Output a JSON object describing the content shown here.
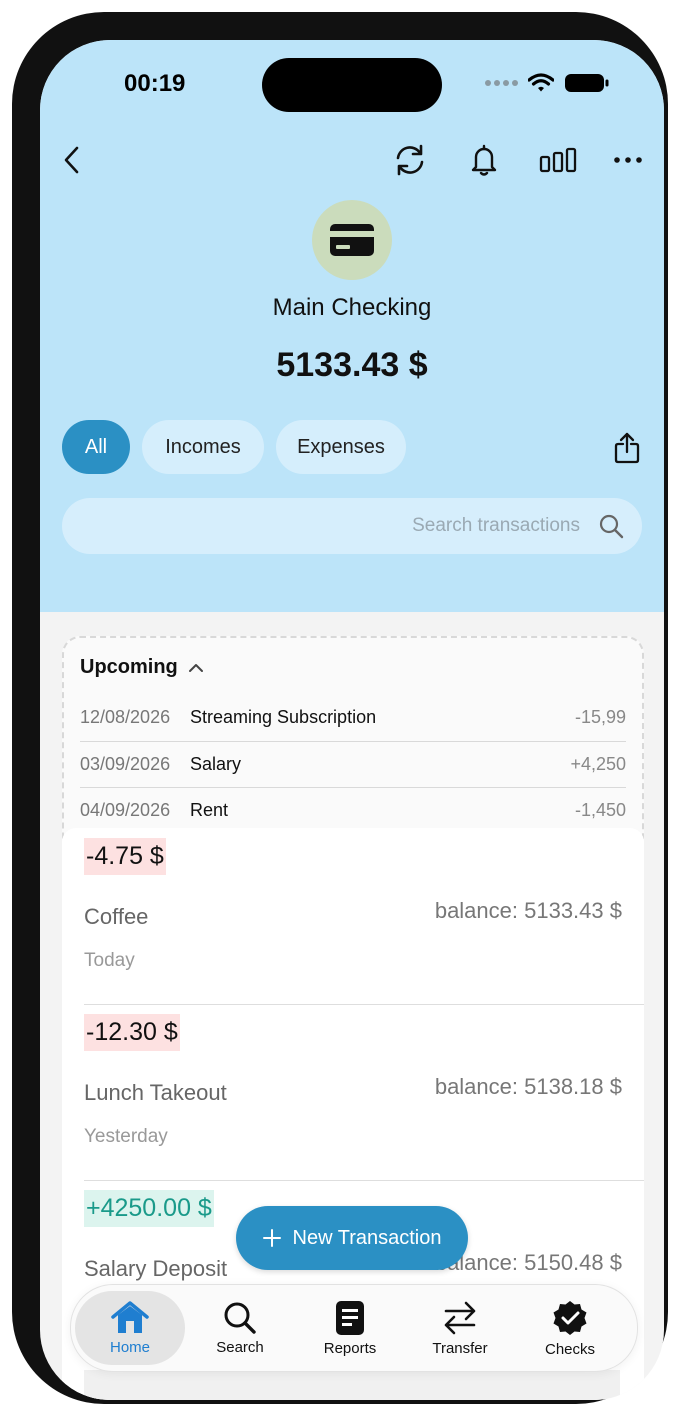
{
  "status_bar": {
    "time": "00:19"
  },
  "account": {
    "name": "Main Checking",
    "balance": "5133.43 $"
  },
  "filters": {
    "all": "All",
    "incomes": "Incomes",
    "expenses": "Expenses"
  },
  "search": {
    "placeholder": "Search transactions"
  },
  "upcoming": {
    "title": "Upcoming",
    "items": [
      {
        "date": "12/08/2026",
        "name": "Streaming Subscription",
        "amount": "-15,99"
      },
      {
        "date": "03/09/2026",
        "name": "Salary",
        "amount": "+4,250"
      },
      {
        "date": "04/09/2026",
        "name": "Rent",
        "amount": "-1,450"
      }
    ]
  },
  "transactions": [
    {
      "amount": "-4.75 $",
      "title": "Coffee",
      "when": "Today",
      "balance": "balance: 5133.43 $",
      "kind": "expense"
    },
    {
      "amount": "-12.30 $",
      "title": "Lunch Takeout",
      "when": "Yesterday",
      "balance": "balance: 5138.18 $",
      "kind": "expense"
    },
    {
      "amount": "+4250.00 $",
      "title": "Salary Deposit",
      "when": "",
      "balance": "balance: 5150.48 $",
      "kind": "income"
    }
  ],
  "fab": {
    "label": "New Transaction"
  },
  "tabs": [
    {
      "label": "Home",
      "icon": "home-icon"
    },
    {
      "label": "Search",
      "icon": "search-icon"
    },
    {
      "label": "Reports",
      "icon": "document-icon"
    },
    {
      "label": "Transfer",
      "icon": "transfer-icon"
    },
    {
      "label": "Checks",
      "icon": "verified-badge-icon"
    }
  ],
  "colors": {
    "header_bg": "#bce4f9",
    "accent": "#2b90c4",
    "expense_bg": "#fde1e1",
    "income_bg": "#dcf4ee",
    "income_text": "#1a9a8a"
  }
}
